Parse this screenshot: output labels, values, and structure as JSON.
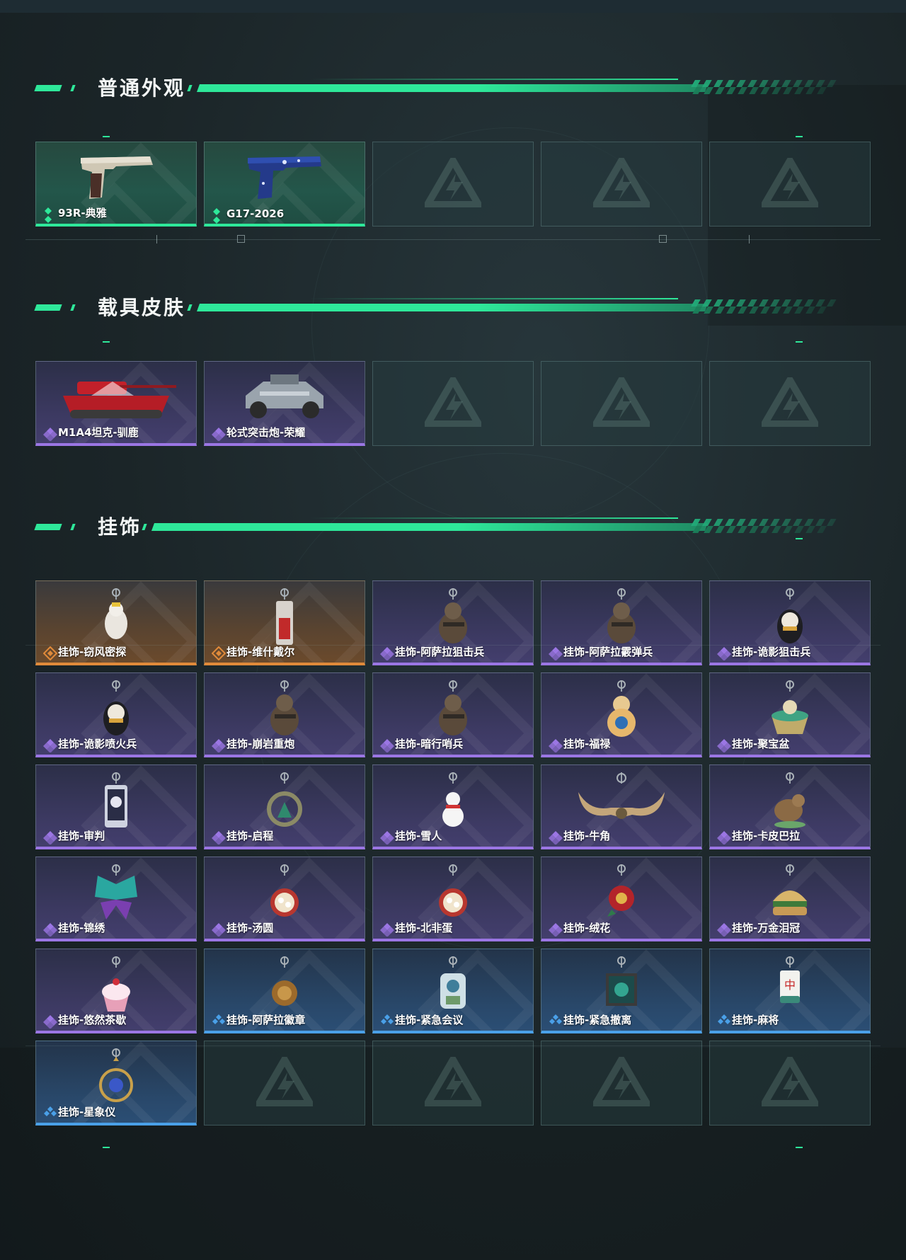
{
  "sections": [
    {
      "title": "普通外观",
      "items": [
        {
          "label": "93R-典雅",
          "rarity": "green",
          "art": "pistol-93r"
        },
        {
          "label": "G17-2026",
          "rarity": "green",
          "art": "pistol-g17"
        }
      ],
      "empty_slots": 3
    },
    {
      "title": "载具皮肤",
      "items": [
        {
          "label": "M1A4坦克-驯鹿",
          "rarity": "purple",
          "art": "tank"
        },
        {
          "label": "轮式突击炮-荣耀",
          "rarity": "purple",
          "art": "armored-car"
        }
      ],
      "empty_slots": 3
    },
    {
      "title": "挂饰",
      "items": [
        {
          "label": "挂饰-窃风密探",
          "rarity": "orange",
          "art": "charm-white-figure"
        },
        {
          "label": "挂饰-维什戴尔",
          "rarity": "orange",
          "art": "charm-red-tag"
        },
        {
          "label": "挂饰-阿萨拉狙击兵",
          "rarity": "purple",
          "art": "charm-soldier"
        },
        {
          "label": "挂饰-阿萨拉霰弹兵",
          "rarity": "purple",
          "art": "charm-soldier"
        },
        {
          "label": "挂饰-诡影狙击兵",
          "rarity": "purple",
          "art": "charm-ghost"
        },
        {
          "label": "挂饰-诡影喷火兵",
          "rarity": "purple",
          "art": "charm-ghost"
        },
        {
          "label": "挂饰-崩岩重炮",
          "rarity": "purple",
          "art": "charm-soldier"
        },
        {
          "label": "挂饰-暗行哨兵",
          "rarity": "purple",
          "art": "charm-soldier"
        },
        {
          "label": "挂饰-福禄",
          "rarity": "purple",
          "art": "charm-gourd"
        },
        {
          "label": "挂饰-聚宝盆",
          "rarity": "purple",
          "art": "charm-bowl"
        },
        {
          "label": "挂饰-审判",
          "rarity": "purple",
          "art": "charm-card"
        },
        {
          "label": "挂饰-启程",
          "rarity": "purple",
          "art": "charm-ring"
        },
        {
          "label": "挂饰-雪人",
          "rarity": "purple",
          "art": "charm-snowman"
        },
        {
          "label": "挂饰-牛角",
          "rarity": "purple",
          "art": "charm-horns"
        },
        {
          "label": "挂饰-卡皮巴拉",
          "rarity": "purple",
          "art": "charm-capybara"
        },
        {
          "label": "挂饰-锦绣",
          "rarity": "purple",
          "art": "charm-butterfly"
        },
        {
          "label": "挂饰-汤圆",
          "rarity": "purple",
          "art": "charm-bowl-round"
        },
        {
          "label": "挂饰-北非蛋",
          "rarity": "purple",
          "art": "charm-bowl-round"
        },
        {
          "label": "挂饰-绒花",
          "rarity": "purple",
          "art": "charm-flower"
        },
        {
          "label": "挂饰-万金泪冠",
          "rarity": "purple",
          "art": "charm-burger"
        },
        {
          "label": "挂饰-悠然茶歇",
          "rarity": "purple",
          "art": "charm-cupcake"
        },
        {
          "label": "挂饰-阿萨拉徽章",
          "rarity": "blue",
          "art": "charm-medal"
        },
        {
          "label": "挂饰-紧急会议",
          "rarity": "blue",
          "art": "charm-figure-blue"
        },
        {
          "label": "挂饰-紧急撤离",
          "rarity": "blue",
          "art": "charm-frame"
        },
        {
          "label": "挂饰-麻将",
          "rarity": "blue",
          "art": "charm-mahjong"
        },
        {
          "label": "挂饰-星象仪",
          "rarity": "blue",
          "art": "charm-orrery"
        }
      ],
      "empty_slots": 4
    }
  ],
  "colors": {
    "accent": "#2ee89a",
    "green": "#2ee89a",
    "purple": "#9b76e4",
    "orange": "#e08a3a",
    "blue": "#4aa0e8"
  }
}
